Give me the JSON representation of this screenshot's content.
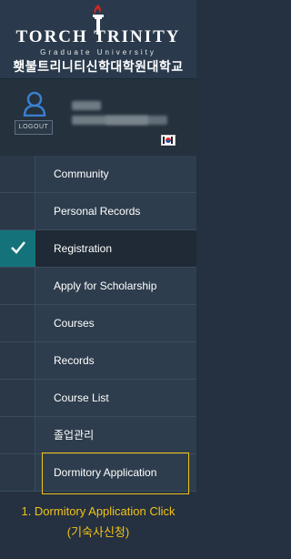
{
  "header": {
    "logo_title": "TORCH TRINITY",
    "logo_subtitle": "Graduate University",
    "logo_korean": "횃불트리니티신학대학원대학교"
  },
  "profile": {
    "logout_label": "LOGOUT",
    "flag": "korea-flag"
  },
  "menu": {
    "items": [
      {
        "label": "Community"
      },
      {
        "label": "Personal Records"
      },
      {
        "label": "Registration"
      },
      {
        "label": "Apply for Scholarship"
      },
      {
        "label": "Courses"
      },
      {
        "label": "Records"
      },
      {
        "label": "Course List"
      },
      {
        "label": "졸업관리"
      },
      {
        "label": "Dormitory Application"
      }
    ],
    "active_index": 2
  },
  "annotation": {
    "line1": "1. Dormitory Application Click",
    "line2": "(기숙사신청)",
    "color": "#f0c419"
  },
  "colors": {
    "accent": "#14737a",
    "highlight": "#f0c419"
  }
}
